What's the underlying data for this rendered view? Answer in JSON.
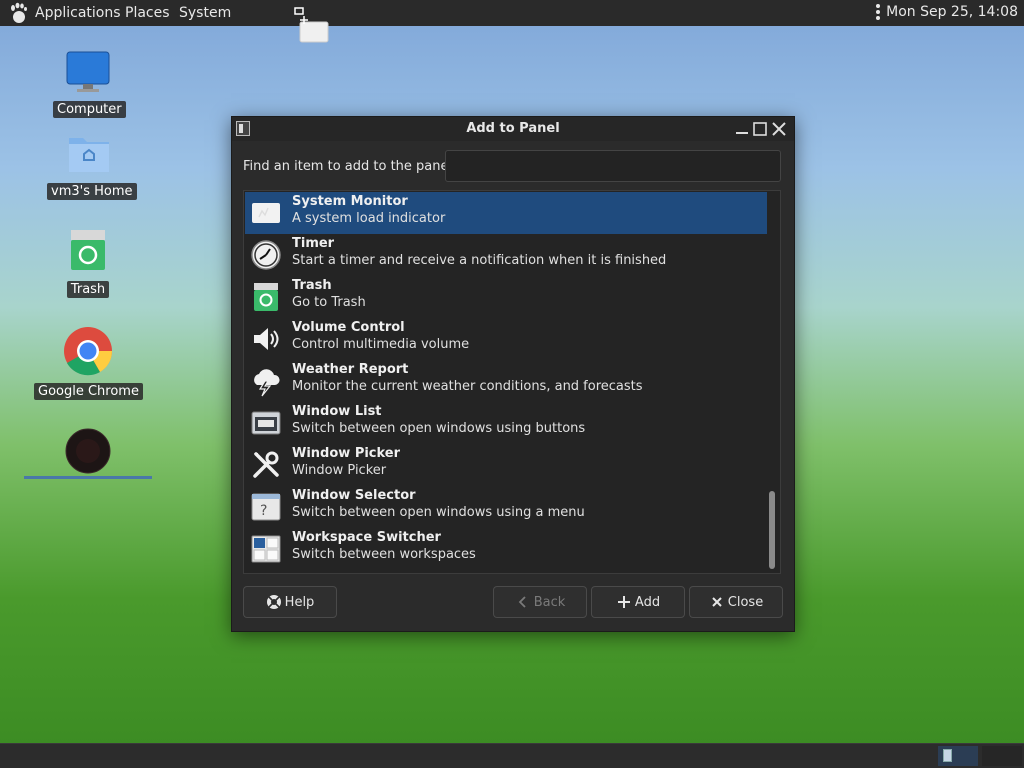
{
  "top_panel": {
    "menus": [
      "Applications",
      "Places",
      "System"
    ],
    "clock": "Mon Sep 25, 14:08"
  },
  "desktop_icons": [
    {
      "label": "Computer",
      "icon": "computer-icon"
    },
    {
      "label": "vm3's Home",
      "icon": "home-folder-icon"
    },
    {
      "label": "Trash",
      "icon": "trash-icon"
    },
    {
      "label": "Google Chrome",
      "icon": "chrome-icon"
    },
    {
      "label": "",
      "icon": "dark-circle-icon"
    }
  ],
  "dialog": {
    "title": "Add to Panel",
    "find_label": "Find an item to add to the panel:",
    "find_value": "",
    "items": [
      {
        "name": "System Monitor",
        "description": "A system load indicator",
        "icon": "system-monitor-icon",
        "selected": true
      },
      {
        "name": "Timer",
        "description": "Start a timer and receive a notification when it is finished",
        "icon": "timer-icon"
      },
      {
        "name": "Trash",
        "description": "Go to Trash",
        "icon": "trash-icon"
      },
      {
        "name": "Volume Control",
        "description": "Control multimedia volume",
        "icon": "speaker-icon"
      },
      {
        "name": "Weather Report",
        "description": "Monitor the current weather conditions, and forecasts",
        "icon": "weather-storm-icon"
      },
      {
        "name": "Window List",
        "description": "Switch between open windows using buttons",
        "icon": "window-list-icon"
      },
      {
        "name": "Window Picker",
        "description": "Window Picker",
        "icon": "tools-icon"
      },
      {
        "name": "Window Selector",
        "description": "Switch between open windows using a menu",
        "icon": "window-selector-icon"
      },
      {
        "name": "Workspace Switcher",
        "description": "Switch between workspaces",
        "icon": "workspace-switcher-icon"
      }
    ],
    "buttons": {
      "help": "Help",
      "back": "Back",
      "add": "Add",
      "close": "Close"
    }
  },
  "colors": {
    "selection": "#1f4b7e",
    "panel": "#2a2a2a",
    "dialog_bg": "#2b2b2b"
  }
}
